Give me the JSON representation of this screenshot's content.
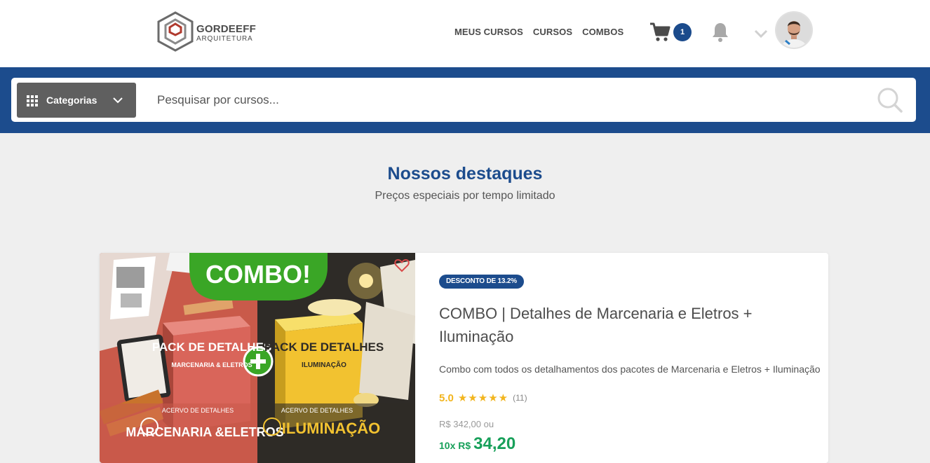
{
  "brand": {
    "name": "GORDEEFF",
    "sub": "ARQUITETURA"
  },
  "nav": {
    "items": [
      "MEUS CURSOS",
      "CURSOS",
      "COMBOS"
    ]
  },
  "cart": {
    "count": "1"
  },
  "search": {
    "category_label": "Categorias",
    "placeholder": "Pesquisar por cursos..."
  },
  "section": {
    "title": "Nossos destaques",
    "subtitle": "Preços especiais por tempo limitado"
  },
  "product": {
    "badge": "DESCONTO DE 13.2%",
    "title": "COMBO | Detalhes de Marcenaria e Eletros + Iluminação",
    "description": "Combo com todos os detalhamentos dos pacotes de Marcenaria e Eletros + Iluminação",
    "rating": "5.0",
    "stars": "★★★★★",
    "rating_count": "(11)",
    "old_price": "R$ 342,00 ou",
    "installment_prefix": "10x R$",
    "installment_value": "34,20",
    "image": {
      "banner": "COMBO!",
      "left_box_title": "PACK DE DETALHES",
      "left_box_sub": "MARCENARIA & ELETROS",
      "right_box_title": "PACK DE DETALHES",
      "right_box_sub": "ILUMINAÇÃO",
      "left_footer_small": "ACERVO DE DETALHES",
      "left_footer_big": "MARCENARIA &ELETROS",
      "right_footer_small": "ACERVO DE DETALHES",
      "right_footer_big": "ILUMINAÇÃO"
    }
  },
  "colors": {
    "accent": "#1c4c8d",
    "price": "#18a05a",
    "star": "#f2b51e",
    "combo_green": "#3aa626",
    "left_bg": "#c95a4a",
    "right_bg": "#2e2b27"
  }
}
